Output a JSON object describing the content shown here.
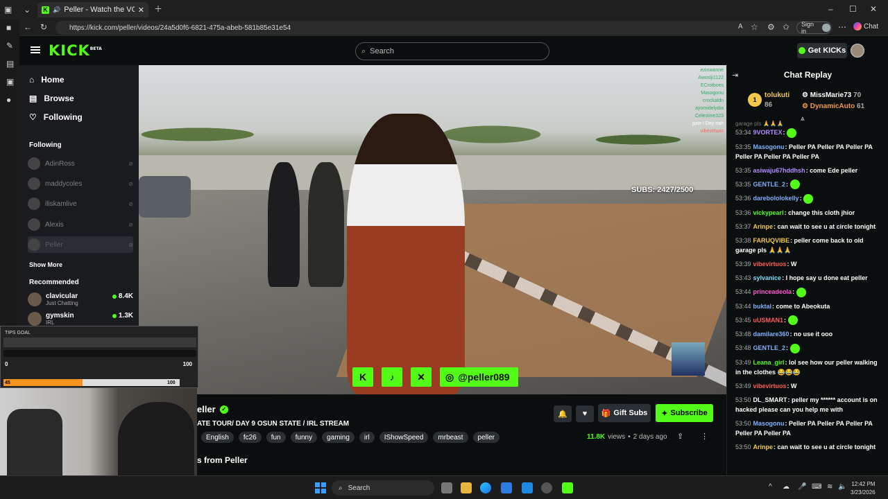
{
  "browser": {
    "tab_title": "Peller - Watch the VOD on Ki...",
    "url": "https://kick.com/peller/videos/24a5d0f6-6821-475a-abeb-581b85e31e54",
    "signin_label": "Sign in",
    "copilot_label": "Chat"
  },
  "header": {
    "logo": "KICK",
    "logo_tag": "BETA",
    "search_placeholder": "Search",
    "get_kicks_label": "Get KICKs"
  },
  "sidebar": {
    "nav": [
      {
        "label": "Home",
        "icon": "home-icon"
      },
      {
        "label": "Browse",
        "icon": "browse-icon"
      },
      {
        "label": "Following",
        "icon": "heart-icon"
      }
    ],
    "following_heading": "Following",
    "following": [
      "AdinRoss",
      "maddycoles",
      "iliskamlive",
      "Alexis",
      "Peller"
    ],
    "show_more": "Show More",
    "recommended_heading": "Recommended",
    "recommended": [
      {
        "name": "clavicular",
        "category": "Just Chatting",
        "viewers": "8.4K"
      },
      {
        "name": "gymskin",
        "category": "IRL",
        "viewers": "1.3K"
      }
    ]
  },
  "video": {
    "subs_text": "SUBS: 2427/2500",
    "handle": "@peller089",
    "overlay_chat": [
      "ezinwanne",
      "Awoslji1122",
      "ECrotboes",
      "Masogonu",
      "crockaldn",
      "ayomidelydia",
      "Celestine323",
      "vibevirtuos"
    ],
    "overlay_chat_line": "gate I Dey nah"
  },
  "tips_goal": {
    "label": "TIPS GOAL",
    "min": "0",
    "max": "100",
    "current": "45",
    "max_b": "100",
    "progress": 0.45
  },
  "info": {
    "channel": "eller",
    "subtitle": "ATE TOUR/ DAY 9 OSUN STATE / IRL STREAM",
    "tags": [
      "English",
      "fc26",
      "fun",
      "funny",
      "gaming",
      "irl",
      "IShowSpeed",
      "mrbeast",
      "peller"
    ],
    "gift_label": "Gift Subs",
    "subscribe_label": "Subscribe",
    "views": "11.8K",
    "views_word": "views",
    "posted": "2 days ago",
    "videos_heading": "s from Peller"
  },
  "chat": {
    "title": "Chat Replay",
    "leaderboard": {
      "first": {
        "name": "tolukuti",
        "value": "86"
      },
      "second": {
        "name": "MissMarie73",
        "value": "70"
      },
      "third": {
        "name": "DynamicAuto",
        "value": "61"
      }
    },
    "partial": "garage pls 🙏🙏🙏",
    "messages": [
      {
        "t": "53:34",
        "u": "9VORTEX",
        "c": "#b38cff",
        "m": ""
      },
      {
        "t": "53:35",
        "u": "Masogonu",
        "c": "#7fb0ff",
        "m": "Peller PA Peller PA Peller PA Peller PA Peller PA Peller PA"
      },
      {
        "t": "53:35",
        "u": "asiwaju67hddhsh",
        "c": "#b38cff",
        "m": "come Ede peller"
      },
      {
        "t": "53:35",
        "u": "GENTLE_2",
        "c": "#7fb0ff",
        "m": ""
      },
      {
        "t": "53:36",
        "u": "darebololokelly",
        "c": "#7fb0ff",
        "m": ""
      },
      {
        "t": "53:36",
        "u": "vickypearl",
        "c": "#53fc18",
        "m": "change this cloth jhior"
      },
      {
        "t": "53:37",
        "u": "Arinpe",
        "c": "#f2c94c",
        "m": "can wait to see u at circle tonight"
      },
      {
        "t": "53:38",
        "u": "FARUQVIBE",
        "c": "#f2c94c",
        "m": "peller come back to old garage pls 🙏🙏🙏"
      },
      {
        "t": "53:39",
        "u": "vibevirtuos",
        "c": "#ff5a5a",
        "m": "W"
      },
      {
        "t": "53:43",
        "u": "sylvanice",
        "c": "#7fdbff",
        "m": "I hope say u done eat peller"
      },
      {
        "t": "53:44",
        "u": "princeadeola",
        "c": "#ff5ad1",
        "m": ""
      },
      {
        "t": "53:44",
        "u": "buktal",
        "c": "#7fb0ff",
        "m": "come to Abeokuta"
      },
      {
        "t": "53:45",
        "u": "uUSMAN1",
        "c": "#ff5a5a",
        "m": ""
      },
      {
        "t": "53:48",
        "u": "damilare360",
        "c": "#7fb0ff",
        "m": "no use it ooo"
      },
      {
        "t": "53:48",
        "u": "GENTLE_2",
        "c": "#7fb0ff",
        "m": ""
      },
      {
        "t": "53:49",
        "u": "Leana_girl",
        "c": "#53fc18",
        "m": "lol see how our peller walking in the clothes 😂😂😂"
      },
      {
        "t": "53:49",
        "u": "vibevirtuos",
        "c": "#ff5a5a",
        "m": "W"
      },
      {
        "t": "53:50",
        "u": "DL_SMART",
        "c": "#fff",
        "m": "peller my ****** account is on hacked please can you help me with"
      },
      {
        "t": "53:50",
        "u": "Masogonu",
        "c": "#7fb0ff",
        "m": "Peller PA Peller PA Peller PA Peller PA Peller PA"
      },
      {
        "t": "53:50",
        "u": "Arinpe",
        "c": "#f2c94c",
        "m": "can wait to see u at circle tonight"
      }
    ]
  },
  "taskbar": {
    "search_label": "Search",
    "time": "12:42 PM",
    "date": "3/23/2026"
  },
  "colors": {
    "accent": "#53fc18",
    "background": "#0b0e0f",
    "sidebar": "#191b1f"
  }
}
